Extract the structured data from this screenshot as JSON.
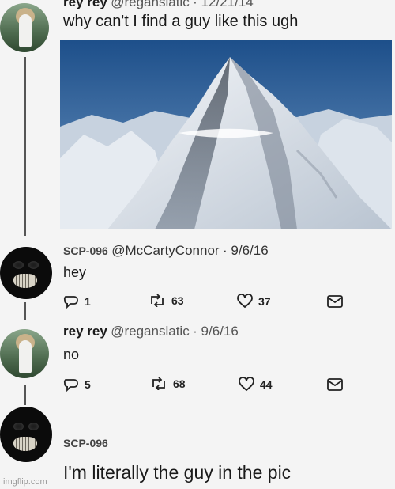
{
  "tweet1": {
    "name": "rey rey",
    "handle": "@reganslatic",
    "date": "· 12/21/14",
    "text": "why can't I find a guy like this ugh"
  },
  "tweet2": {
    "name": "SCP-096",
    "handle": "@McCartyConnor",
    "date": "· 9/6/16",
    "text": "hey",
    "replies": "1",
    "retweets": "63",
    "likes": "37"
  },
  "tweet3": {
    "name": "rey rey",
    "handle": "@reganslatic",
    "date": "· 9/6/16",
    "text": "no",
    "replies": "5",
    "retweets": "68",
    "likes": "44"
  },
  "tweet4": {
    "name": "SCP-096",
    "text": "I'm literally the guy in the pic"
  },
  "watermark": "imgflip.com",
  "icons": {
    "reply": "reply-icon",
    "retweet": "retweet-icon",
    "like": "heart-icon",
    "message": "envelope-icon"
  }
}
